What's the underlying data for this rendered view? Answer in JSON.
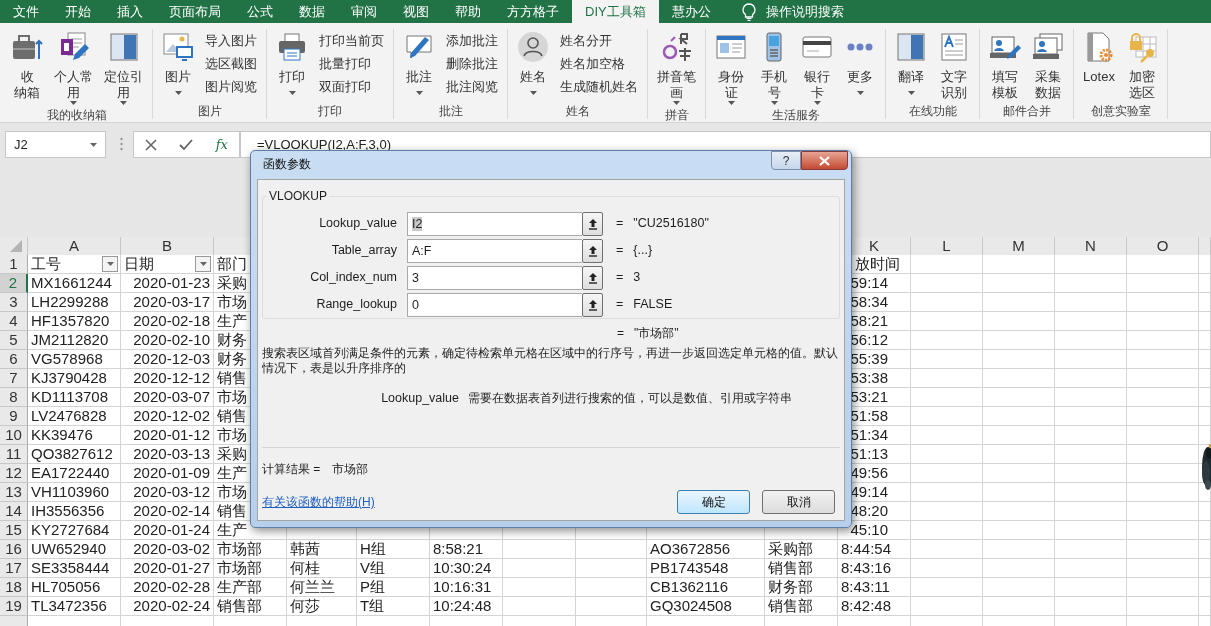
{
  "ribbon": {
    "tabs": [
      {
        "label": "文件",
        "selected": false
      },
      {
        "label": "开始",
        "selected": false
      },
      {
        "label": "插入",
        "selected": false
      },
      {
        "label": "页面布局",
        "selected": false
      },
      {
        "label": "公式",
        "selected": false
      },
      {
        "label": "数据",
        "selected": false
      },
      {
        "label": "审阅",
        "selected": false
      },
      {
        "label": "视图",
        "selected": false
      },
      {
        "label": "帮助",
        "selected": false
      },
      {
        "label": "方方格子",
        "selected": false
      },
      {
        "label": "DIY工具箱",
        "selected": true
      },
      {
        "label": "慧办公",
        "selected": false
      }
    ],
    "search": "操作说明搜索",
    "groups": [
      {
        "label": "我的收纳箱",
        "large": [
          {
            "lines": [
              "收",
              "纳箱"
            ],
            "dropdown": false
          },
          {
            "lines": [
              "个人常",
              "用"
            ],
            "dropdown": true
          },
          {
            "lines": [
              "定位引",
              "用"
            ],
            "dropdown": true
          }
        ]
      },
      {
        "label": "图片",
        "large": [
          {
            "lines": [
              "图片"
            ],
            "dropdown": true
          }
        ],
        "small": [
          "导入图片",
          "选区截图",
          "图片阅览"
        ]
      },
      {
        "label": "打印",
        "large": [
          {
            "lines": [
              "打印"
            ],
            "dropdown": true
          }
        ],
        "small": [
          "打印当前页",
          "批量打印",
          "双面打印"
        ]
      },
      {
        "label": "批注",
        "large": [
          {
            "lines": [
              "批注"
            ],
            "dropdown": true
          }
        ],
        "small": [
          "添加批注",
          "删除批注",
          "批注阅览"
        ]
      },
      {
        "label": "姓名",
        "large": [
          {
            "lines": [
              "姓名"
            ],
            "dropdown": true
          }
        ],
        "small": [
          "姓名分开",
          "姓名加空格",
          "生成随机姓名"
        ]
      },
      {
        "label": "拼音",
        "large": [
          {
            "lines": [
              "拼音笔",
              "画"
            ],
            "dropdown": true
          }
        ]
      },
      {
        "label": "生活服务",
        "large": [
          {
            "lines": [
              "身份",
              "证"
            ],
            "dropdown": true
          },
          {
            "lines": [
              "手机",
              "号"
            ],
            "dropdown": true
          },
          {
            "lines": [
              "银行",
              "卡"
            ],
            "dropdown": true
          },
          {
            "lines": [
              "更多"
            ],
            "dropdown": true
          }
        ]
      },
      {
        "label": "在线功能",
        "large": [
          {
            "lines": [
              "翻译"
            ],
            "dropdown": true
          },
          {
            "lines": [
              "文字",
              "识别"
            ],
            "dropdown": false
          }
        ]
      },
      {
        "label": "邮件合并",
        "large": [
          {
            "lines": [
              "填写",
              "模板"
            ],
            "dropdown": false
          },
          {
            "lines": [
              "采集",
              "数据"
            ],
            "dropdown": false
          }
        ]
      },
      {
        "label": "创意实验室",
        "large": [
          {
            "lines": [
              "Lotex"
            ],
            "dropdown": false
          },
          {
            "lines": [
              "加密",
              "选区"
            ],
            "dropdown": false
          }
        ]
      }
    ]
  },
  "formula_bar": {
    "name_box": "J2",
    "function_button": "fx",
    "formula": "=VLOOKUP(I2,A:F,3,0)"
  },
  "sheet": {
    "column_headers_left": [
      "A",
      "B"
    ],
    "column_headers_right": [
      "K",
      "L",
      "M",
      "N",
      "O"
    ],
    "header_row": {
      "number": "1",
      "cells": [
        {
          "text": "工号",
          "filter": true
        },
        {
          "text": "日期",
          "filter": true
        },
        {
          "text": "部门"
        }
      ],
      "right_cells": [
        {
          "text": "放时间"
        }
      ]
    },
    "rows": [
      {
        "number": "2",
        "selected": true,
        "cells": [
          "MX1661244",
          "2020-01-23",
          "采购"
        ],
        "right_cells": [
          "59:14"
        ]
      },
      {
        "number": "3",
        "selected": false,
        "cells": [
          "LH2299288",
          "2020-03-17",
          "市场"
        ],
        "right_cells": [
          "58:34"
        ]
      },
      {
        "number": "4",
        "selected": false,
        "cells": [
          "HF1357820",
          "2020-02-18",
          "生产"
        ],
        "right_cells": [
          "58:21"
        ]
      },
      {
        "number": "5",
        "selected": false,
        "cells": [
          "JM2112820",
          "2020-02-10",
          "财务"
        ],
        "right_cells": [
          "56:12"
        ]
      },
      {
        "number": "6",
        "selected": false,
        "cells": [
          "VG578968",
          "2020-12-03",
          "财务"
        ],
        "right_cells": [
          "55:39"
        ]
      },
      {
        "number": "7",
        "selected": false,
        "cells": [
          "KJ3790428",
          "2020-12-12",
          "销售"
        ],
        "right_cells": [
          "53:38"
        ]
      },
      {
        "number": "8",
        "selected": false,
        "cells": [
          "KD1113708",
          "2020-03-07",
          "市场"
        ],
        "right_cells": [
          "53:21"
        ]
      },
      {
        "number": "9",
        "selected": false,
        "cells": [
          "LV2476828",
          "2020-12-02",
          "销售"
        ],
        "right_cells": [
          "51:58"
        ]
      },
      {
        "number": "10",
        "selected": false,
        "cells": [
          "KK39476",
          "2020-01-12",
          "市场"
        ],
        "right_cells": [
          "51:34"
        ]
      },
      {
        "number": "11",
        "selected": false,
        "cells": [
          "QO3827612",
          "2020-03-13",
          "采购"
        ],
        "right_cells": [
          "51:13"
        ]
      },
      {
        "number": "12",
        "selected": false,
        "cells": [
          "EA1722440",
          "2020-01-09",
          "生产"
        ],
        "right_cells": [
          "49:56"
        ]
      },
      {
        "number": "13",
        "selected": false,
        "cells": [
          "VH1103960",
          "2020-03-12",
          "市场"
        ],
        "right_cells": [
          "49:14"
        ]
      },
      {
        "number": "14",
        "selected": false,
        "cells": [
          "IH3556356",
          "2020-02-14",
          "销售"
        ],
        "right_cells": [
          "48:20"
        ]
      },
      {
        "number": "15",
        "selected": false,
        "cells": [
          "KY2727684",
          "2020-01-24",
          "生产"
        ],
        "right_cells": [
          "45:10"
        ]
      },
      {
        "number": "16",
        "selected": false,
        "cells": [
          "UW652940",
          "2020-03-02",
          "市场部",
          "韩茜",
          "H组",
          "8:58:21"
        ],
        "right_cells": [
          "AO3672856",
          "采购部",
          "8:44:54"
        ]
      },
      {
        "number": "17",
        "selected": false,
        "cells": [
          "SE3358444",
          "2020-01-27",
          "市场部",
          "何桂",
          "V组",
          "10:30:24"
        ],
        "right_cells": [
          "PB1743548",
          "销售部",
          "8:43:16"
        ]
      },
      {
        "number": "18",
        "selected": false,
        "cells": [
          "HL705056",
          "2020-02-28",
          "生产部",
          "何兰兰",
          "P组",
          "10:16:31"
        ],
        "right_cells": [
          "CB1362116",
          "财务部",
          "8:43:11"
        ]
      },
      {
        "number": "19",
        "selected": false,
        "cells": [
          "TL3472356",
          "2020-02-24",
          "销售部",
          "何莎",
          "T组",
          "10:24:48"
        ],
        "right_cells": [
          "GQ3024508",
          "销售部",
          "8:42:48"
        ]
      }
    ]
  },
  "dialog": {
    "title": "函数参数",
    "help": "?",
    "function_name": "VLOOKUP",
    "arguments": [
      {
        "label": "Lookup_value",
        "value": "I2",
        "text_selected": true,
        "sign": "=",
        "result": "\"CU2516180\""
      },
      {
        "label": "Table_array",
        "value": "A:F",
        "text_selected": false,
        "sign": "=",
        "result": "{...}"
      },
      {
        "label": "Col_index_num",
        "value": "3",
        "text_selected": false,
        "sign": "=",
        "result": "3"
      },
      {
        "label": "Range_lookup",
        "value": "0",
        "text_selected": false,
        "sign": "=",
        "result": "FALSE"
      }
    ],
    "formula_result": {
      "sign": "=",
      "value": "\"市场部\""
    },
    "description": "搜索表区域首列满足条件的元素，确定待检索单元格在区域中的行序号，再进一步返回选定单元格的值。默认情况下，表是以升序排序的",
    "argument_help": {
      "name": "Lookup_value",
      "text": "需要在数据表首列进行搜索的值，可以是数值、引用或字符串"
    },
    "calc_result": {
      "label": "计算结果 =",
      "value": "市场部"
    },
    "help_link": "有关该函数的帮助(H)",
    "buttons": [
      {
        "label": "确定",
        "focused": true
      },
      {
        "label": "取消",
        "focused": false
      }
    ]
  }
}
